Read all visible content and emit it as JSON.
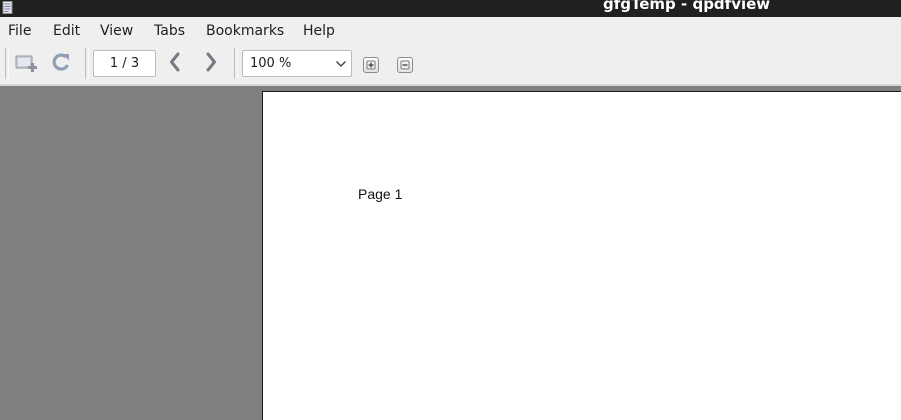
{
  "window": {
    "title": "gfgTemp - qpdfview"
  },
  "menu": [
    "File",
    "Edit",
    "View",
    "Tabs",
    "Bookmarks",
    "Help"
  ],
  "toolbar": {
    "page_indicator": "1 / 3",
    "zoom": "100 %",
    "icons": {
      "open_in_new_tab": "open-in-new-tab-icon",
      "refresh": "refresh-icon",
      "previous_page": "chevron-left-icon",
      "next_page": "chevron-right-icon",
      "zoom_in": "plus-icon",
      "zoom_out": "minus-icon"
    }
  },
  "document": {
    "page_text": "Page 1"
  },
  "colors": {
    "titlebar": "#202020",
    "chrome": "#efefef",
    "viewport_background": "#808080",
    "page": "#ffffff"
  }
}
